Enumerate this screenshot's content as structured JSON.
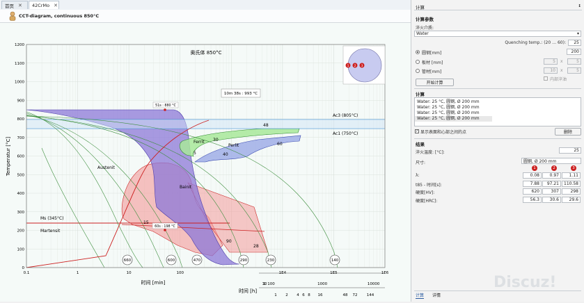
{
  "tabs": [
    {
      "label": "首页"
    },
    {
      "label": "42CrMo"
    }
  ],
  "header": {
    "title": "CCT-diagram, continuous 850°C"
  },
  "chart_data": {
    "type": "line",
    "title": "奥氏体 850°C",
    "ylabel": "Temperatur [°C]",
    "xlabel": "时间 [min]",
    "x2label": "时间 [h]",
    "xscale": "log",
    "xlim": [
      0.1,
      1000000
    ],
    "ylim": [
      0,
      1200
    ],
    "xticks": [
      "0.1",
      "1",
      "10",
      "100",
      "1E4",
      "1E5",
      "1E6"
    ],
    "yticks": [
      "0",
      "100",
      "200",
      "300",
      "400",
      "500",
      "600",
      "700",
      "800",
      "900",
      "1000",
      "1100",
      "1200"
    ],
    "hours_ticks_upper": [
      "1",
      "10",
      "100",
      "1000",
      "10000"
    ],
    "hours_ticks_lower": [
      "1",
      "2",
      "4",
      "6",
      "8",
      "16",
      "48",
      "72",
      "144"
    ],
    "ac3": {
      "label": "Ac3 (805°C)",
      "value": 805
    },
    "ac1": {
      "label": "Ac1 (750°C)",
      "value": 750
    },
    "ms": {
      "label": "Ms (345°C)",
      "value": 345
    },
    "annotations": {
      "top_time": "10m 38s : 993 °C",
      "pt1": "51s : 880 °C",
      "pt2": "60s : 198 °C"
    },
    "regions": {
      "ferrite": "Ferrit",
      "pearlite": "Perlit",
      "bainite": "Bainit",
      "austenite": "Austenit",
      "martensite": "Martensit"
    },
    "phase_numbers": [
      "48",
      "30",
      "40",
      "60",
      "5",
      "15",
      "60",
      "90",
      "28"
    ],
    "hardness_labels": [
      "660",
      "600",
      "470",
      "290",
      "230",
      "140"
    ]
  },
  "panel": {
    "title": "计算",
    "close_icon": "pin-icon",
    "params_title": "计算参数",
    "quench_medium_label": "淬火介质:",
    "quench_medium_value": "Water",
    "quench_temp_label": "Quenching temp.: (20 … 60):",
    "quench_temp_value": "25",
    "round_label": "圆钢[mm]",
    "round_value": "200",
    "plate_label": "板材 [mm]",
    "plate_v1": "5",
    "plate_x": "x",
    "plate_v2": "5",
    "tube_label": "管材[mm]",
    "tube_v1": "10",
    "tube_x": "x",
    "tube_v2": "5",
    "inner_quench_label": "内部淬油",
    "start_button": "开始计算",
    "calc_title": "计算",
    "calc_items": [
      "Water: 25 °C, 圆钢, Ø 200 mm",
      "Water: 25 °C, 圆钢, Ø 200 mm",
      "Water: 25 °C, 圆钢, Ø 200 mm",
      "Water: 25 °C, 圆钢, Ø 200 mm"
    ],
    "show_surface_label": "显示表面和心部之间的点",
    "delete_button": "删除",
    "results_title": "结果",
    "quench_temp_result_label": "淬火温度: [°C]:",
    "quench_temp_result_value": "25",
    "size_label": "尺寸:",
    "size_value": "圆钢, Ø 200 mm",
    "badges": [
      "1",
      "2",
      "3"
    ],
    "rows": [
      {
        "label": "λ:",
        "values": [
          "0.08",
          "0.97",
          "1.11"
        ]
      },
      {
        "label": "t85 - 时间[s]:",
        "values": [
          "7.88",
          "97.21",
          "110.58"
        ]
      },
      {
        "label": "硬度[HV]:",
        "values": [
          "620",
          "307",
          "298"
        ]
      },
      {
        "label": "硬度[HRC]:",
        "values": [
          "56.3",
          "30.6",
          "29.6"
        ]
      }
    ],
    "bottom_tabs": [
      "计算",
      "详情"
    ]
  },
  "watermark": "Discuz!"
}
